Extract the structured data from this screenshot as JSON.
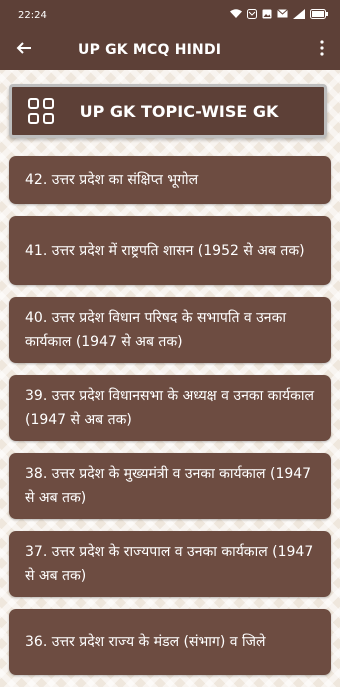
{
  "status": {
    "time": "22:24",
    "icons": [
      "wifi-icon",
      "message-icon",
      "gallery-icon",
      "mail-icon",
      "signal-icon",
      "battery-icon"
    ]
  },
  "appbar": {
    "title": "UP GK MCQ HINDI"
  },
  "banner": {
    "text": "UP GK  TOPIC-WISE GK"
  },
  "topics": [
    "42. उत्तर प्रदेश का संक्षिप्त भूगोल",
    "41. उत्तर प्रदेश में राष्ट्रपति शासन (1952 से अब तक)",
    "40. उत्तर प्रदेश विधान परिषद के सभापति व उनका कार्यकाल (1947 से अब तक)",
    "39. उत्तर प्रदेश विधानसभा के अध्यक्ष व उनका कार्यकाल (1947 से अब तक)",
    "38. उत्तर प्रदेश के मुख्यमंत्री व उनका कार्यकाल (1947 से अब तक)",
    "37. उत्तर प्रदेश के राज्यपाल व उनका कार्यकाल (1947 से अब तक)",
    "36. उत्तर प्रदेश राज्य के मंडल (संभाग) व जिले"
  ],
  "colors": {
    "primary": "#5d4037",
    "card": "#6d4c41",
    "background": "#efe7dd"
  }
}
